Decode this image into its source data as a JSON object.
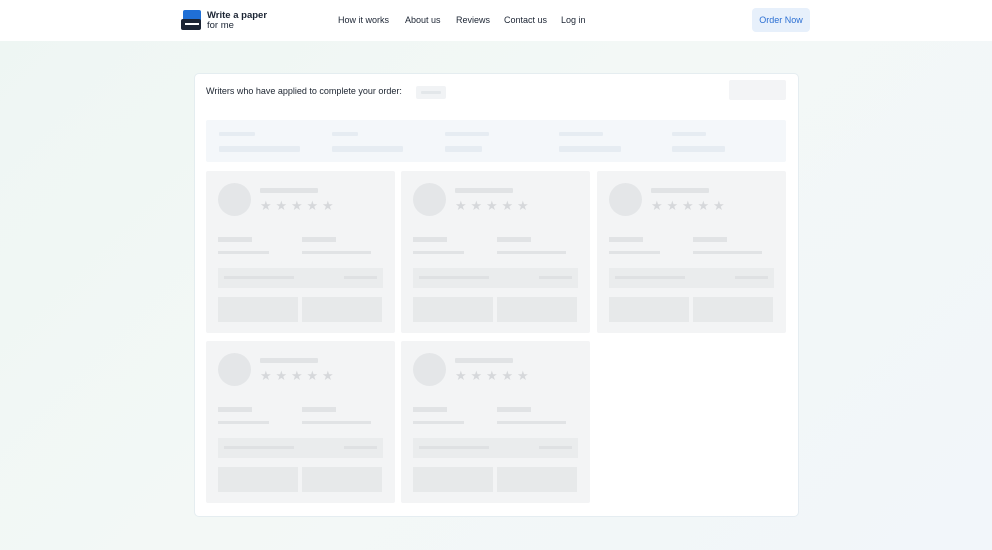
{
  "header": {
    "logo_line1": "Write a paper",
    "logo_line2": "for me",
    "nav": [
      "How it works",
      "About us",
      "Reviews",
      "Contact us",
      "Log in"
    ],
    "cta_label": "Order Now"
  },
  "main": {
    "title": "Writers who have applied to complete your order:"
  },
  "colors": {
    "brand_blue": "#1f6fd6",
    "brand_dark": "#1b2433",
    "cta_bg": "#e7f0fb",
    "cta_text": "#2b6fd3"
  },
  "icons": {
    "star": "★"
  }
}
